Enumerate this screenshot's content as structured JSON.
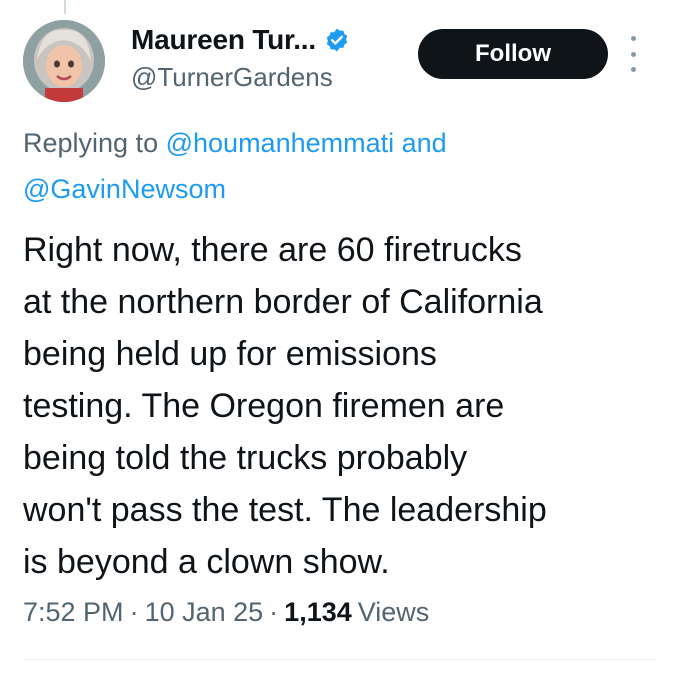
{
  "author": {
    "display_name": "Maureen Tur...",
    "handle": "@TurnerGardens",
    "verified": true,
    "avatar": "avatar-cartoon-woman"
  },
  "follow_label": "Follow",
  "more_icon": "more-vertical-icon",
  "reply_context": {
    "prefix": "Replying to",
    "mention_1": "@houmanhemmati",
    "joiner": "and",
    "mention_2": "@GavinNewsom"
  },
  "tweet": {
    "text": "Right now, there are 60 firetrucks\nat the northern border of California\nbeing held up for emissions\ntesting. The Oregon firemen are\nbeing told the trucks probably\nwon't pass the test. The leadership\nis beyond a clown show."
  },
  "meta": {
    "time": "7:52 PM",
    "separator": "·",
    "date": "10 Jan 25",
    "views_count": "1,134",
    "views_label": "Views"
  },
  "colors": {
    "accent": "#1d9bf0",
    "text": "#0f1419",
    "muted": "#536471",
    "follow_bg": "#0f1419"
  }
}
